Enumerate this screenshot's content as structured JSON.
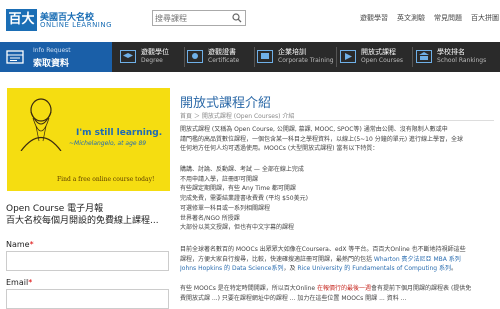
{
  "header": {
    "logo_mark": "百大",
    "logo_cn": "美國百大名校",
    "logo_en": "ONLINE LEARNING",
    "search_placeholder": "搜尋課程",
    "top_links": [
      "遊觀學習",
      "英文測驗",
      "常見問題",
      "百大拼圖"
    ]
  },
  "nav": {
    "info_en": "Info Request",
    "info_cn": "索取資料",
    "items": [
      {
        "cn": "遊觀學位",
        "en": "Degree",
        "icon": "graduation-cap-icon"
      },
      {
        "cn": "遊觀證書",
        "en": "Certificate",
        "icon": "certificate-icon"
      },
      {
        "cn": "企業培訓",
        "en": "Corporate Training",
        "icon": "training-icon"
      },
      {
        "cn": "開放式課程",
        "en": "Open Courses",
        "icon": "open-course-icon"
      },
      {
        "cn": "學校排名",
        "en": "School Rankings",
        "icon": "school-icon"
      }
    ]
  },
  "sidebar": {
    "promo_tagline": "I'm still learning.",
    "promo_author": "~Michelangelo, at age 89",
    "promo_footer": "Find a free online course today!",
    "newsletter_title": "Open Course 電子月報",
    "newsletter_sub": "百大名校每個月開設的免費線上課程...",
    "name_label": "Name",
    "email_label": "Email",
    "required_mark": "*"
  },
  "main": {
    "title": "開放式課程介紹",
    "breadcrumb": "首頁 ＞ 開放式課程 (Open Courses) 介紹",
    "para1": [
      "開放式課程 (又稱為 Open Course, 公開課, 慕課, MOOC, SPOC等) 通常由公開、沒有限制人數或申",
      "請門檻的高品質數位課程，一個包含某一科目之學程資料，以線上(5~10 分鐘的單元) 進行線上學習，全球",
      "任何地方任何人均可透過使用。MOOCs (大型開放式課程) 當有以下特質："
    ],
    "list": [
      "購講、討論、反動課、考試 — 全部在線上完成",
      "不用申請入學，註冊即可開課",
      "有些課定期開課，有些 Any Time 都可開課",
      "完成免費，需要結業證書收費費 (平均 $50美元)",
      "可選修單一科目或一系列相關課程",
      "世界著名/NGO 所授課",
      "大部份以英文授課，但也有中文字幕的課程"
    ],
    "para2_prefix": "目前全球著名數百的 MOOCs 出眾眾大如像在Coursera、edX 等平台。百百大Online 也不斷地持視師這些",
    "para2_line2": "課程，方便大家自行搜尋，比較，快速確搜適註冊可開課，最熱門的包括 ",
    "para2_link1": "Wharton 賓夕法尼亞 MBA 系列",
    "para2_link2": "Johns Hopkins 的 Data Science系列",
    "para2_mid": "，及 ",
    "para2_link3": "Rice University 的 Fundamentals of Computing 系列",
    "para2_end": "。",
    "para3_prefix": "有些 MOOCs 是在特定時間開課，所以百大Online ",
    "para3_red": "在報價行的最後一週",
    "para3_suffix": "會有提前下個月開課的課程表 (提供免",
    "para3_line2": "費開放式課 ...) 只要在課程網址中的課程 ... 加力在這些位置 MOOCs 開課 ... 資料 ..."
  },
  "colors": {
    "brand_blue": "#1b6eb5",
    "nav_dark": "#2a2a2a",
    "promo_yellow": "#f5dd11",
    "title_blue": "#2d6aa8"
  }
}
